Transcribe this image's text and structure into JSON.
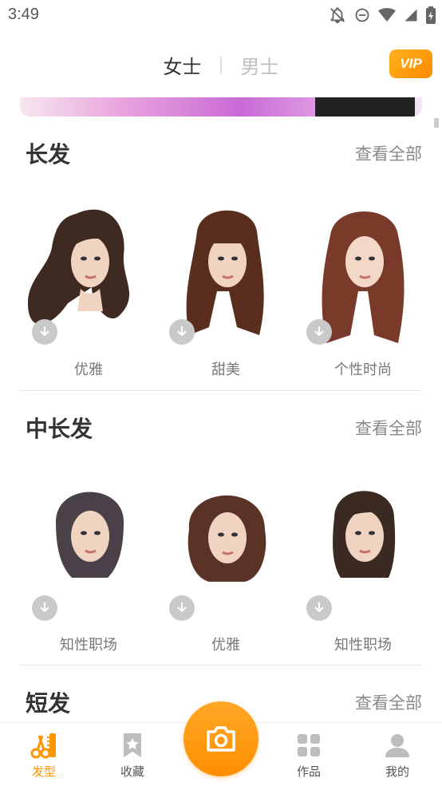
{
  "status_bar": {
    "time": "3:49",
    "icons": [
      "notifications-off-icon",
      "do-not-disturb-icon",
      "wifi-icon",
      "signal-icon",
      "battery-icon"
    ]
  },
  "header": {
    "tabs": [
      {
        "label": "女士",
        "active": true
      },
      {
        "label": "男士",
        "active": false
      }
    ],
    "vip_label": "VIP"
  },
  "sections": [
    {
      "title": "长发",
      "view_all": "查看全部",
      "items": [
        {
          "label": "优雅",
          "hair_color": "#3e2a20",
          "style": "wavy-side"
        },
        {
          "label": "甜美",
          "hair_color": "#5a2e1e",
          "style": "bangs-long"
        },
        {
          "label": "个性时尚",
          "hair_color": "#7a3a2a",
          "style": "curly-long"
        }
      ]
    },
    {
      "title": "中长发",
      "view_all": "查看全部",
      "items": [
        {
          "label": "知性职场",
          "hair_color": "#4a4048",
          "style": "bob-side"
        },
        {
          "label": "优雅",
          "hair_color": "#5b3226",
          "style": "wavy-mid"
        },
        {
          "label": "知性职场",
          "hair_color": "#3b2a22",
          "style": "straight-mid"
        }
      ]
    },
    {
      "title": "短发",
      "view_all": "查看全部",
      "items": []
    }
  ],
  "bottom_nav": {
    "items": [
      {
        "label": "发型",
        "icon": "scissors-comb-icon",
        "active": true
      },
      {
        "label": "收藏",
        "icon": "bookmark-star-icon",
        "active": false
      },
      {
        "label": "",
        "icon": "camera-icon",
        "active": false
      },
      {
        "label": "作品",
        "icon": "grid-icon",
        "active": false
      },
      {
        "label": "我的",
        "icon": "user-icon",
        "active": false
      }
    ]
  },
  "colors": {
    "accent": "#ff9500",
    "vip_gradient_start": "#ffb21e",
    "vip_gradient_end": "#ff8a00",
    "download_bg": "#c9c9c9"
  }
}
